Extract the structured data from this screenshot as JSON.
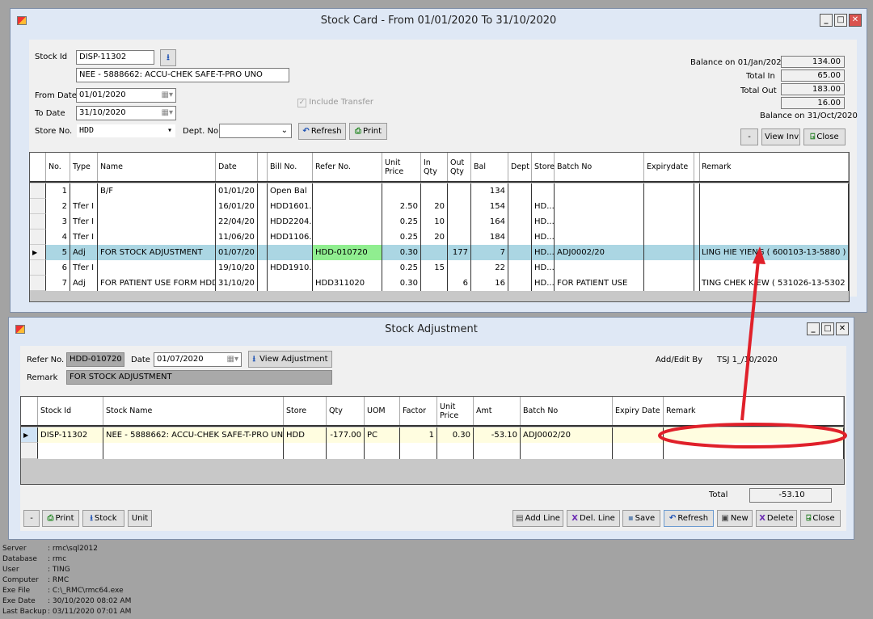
{
  "stock_card": {
    "title": "Stock Card - From 01/01/2020  To  31/10/2020",
    "stock_id_label": "Stock Id",
    "stock_id": "DISP-11302",
    "stock_name": "NEE - 5888662: ACCU-CHEK SAFE-T-PRO UNO",
    "from_date_label": "From Date",
    "from_date": "01/01/2020",
    "to_date_label": "To Date",
    "to_date": "31/10/2020",
    "store_label": "Store No.",
    "store": "HDD",
    "dept_label": "Dept. No",
    "dept": "",
    "include_transfer_label": "Include Transfer",
    "include_transfer_checked": true,
    "refresh_label": "Refresh",
    "print_label": "Print",
    "balance_open_label": "Balance on 01/Jan/2020",
    "balance_open": "134.00",
    "total_in_label": "Total In",
    "total_in": "65.00",
    "total_out_label": "Total Out",
    "total_out": "183.00",
    "balance_close": "16.00",
    "balance_close_label": "Balance on 31/Oct/2020",
    "minus_label": "-",
    "view_inv_label": "View Inv",
    "close_label": "Close",
    "columns": [
      "No.",
      "Type",
      "Name",
      "Date",
      "",
      "Bill No.",
      "Refer No.",
      "Unit Price",
      "In Qty",
      "Out Qty",
      "Bal",
      "Dept",
      "Store",
      "Batch No",
      "Expirydate",
      "",
      "Remark"
    ],
    "rows": [
      [
        "1",
        "",
        "B/F",
        "01/01/20",
        "",
        "Open Bal",
        "",
        "",
        "",
        "",
        "134",
        "",
        "",
        "",
        "",
        "",
        ""
      ],
      [
        "2",
        "Tfer I",
        "",
        "16/01/20",
        "",
        "HDD1601...",
        "",
        "2.50",
        "20",
        "",
        "154",
        "",
        "HD...",
        "",
        "",
        "",
        ""
      ],
      [
        "3",
        "Tfer I",
        "",
        "22/04/20",
        "",
        "HDD2204...",
        "",
        "0.25",
        "10",
        "",
        "164",
        "",
        "HD...",
        "",
        "",
        "",
        ""
      ],
      [
        "4",
        "Tfer I",
        "",
        "11/06/20",
        "",
        "HDD1106...",
        "",
        "0.25",
        "20",
        "",
        "184",
        "",
        "HD...",
        "",
        "",
        "",
        ""
      ],
      [
        "5",
        "Adj",
        "FOR STOCK ADJUSTMENT",
        "01/07/20",
        "",
        "",
        "HDD-010720",
        "0.30",
        "",
        "177",
        "7",
        "",
        "HD...",
        "ADJ0002/20",
        "",
        "",
        "LING HIE YIENG ( 600103-13-5880 )"
      ],
      [
        "6",
        "Tfer I",
        "",
        "19/10/20",
        "",
        "HDD1910...",
        "",
        "0.25",
        "15",
        "",
        "22",
        "",
        "HD...",
        "",
        "",
        "",
        ""
      ],
      [
        "7",
        "Adj",
        "FOR PATIENT USE FORM HDD",
        "31/10/20",
        "",
        "",
        "HDD311020",
        "0.30",
        "",
        "6",
        "16",
        "",
        "HD...",
        "FOR PATIENT USE",
        "",
        "",
        "TING CHEK KIEW ( 531026-13-5302 )"
      ]
    ],
    "selected_row": 4,
    "highlight_color": "#90ee90"
  },
  "stock_adjustment": {
    "title": "Stock Adjustment",
    "refer_label": "Refer No.",
    "refer_no": "HDD-010720",
    "date_label": "Date",
    "date": "01/07/2020",
    "view_adjustment_label": "View Adjustment",
    "remark_label": "Remark",
    "remark": "FOR STOCK ADJUSTMENT",
    "add_edit_label": "Add/Edit By",
    "add_edit_value": "TSJ 1_/10/2020",
    "columns": [
      "Stock Id",
      "Stock Name",
      "Store",
      "Qty",
      "UOM",
      "Factor",
      "Unit Price",
      "Amt",
      "Batch No",
      "Expiry Date",
      "Remark"
    ],
    "rows": [
      [
        "DISP-11302",
        "NEE - 5888662: ACCU-CHEK SAFE-T-PRO UNO",
        "HDD",
        "-177.00",
        "PC",
        "1",
        "0.30",
        "-53.10",
        "ADJ0002/20",
        "",
        ""
      ]
    ],
    "total_label": "Total",
    "total": "-53.10",
    "buttons_left": [
      "-",
      "Print",
      "Stock",
      "Unit"
    ],
    "buttons_right": [
      "Add Line",
      "Del. Line",
      "Save",
      "Refresh",
      "New",
      "Delete",
      "Close"
    ]
  },
  "status": [
    [
      "Server",
      ": rmc\\sql2012"
    ],
    [
      "Database",
      ": rmc"
    ],
    [
      "User",
      ": TING"
    ],
    [
      "Computer",
      ": RMC"
    ],
    [
      "Exe File",
      ": C:\\_RMC\\rmc64.exe"
    ],
    [
      "Exe Date",
      ": 30/10/2020 08:02 AM"
    ],
    [
      "Last Backup",
      ": 03/11/2020 07:01 AM"
    ]
  ],
  "annotation_color": "#e0202a"
}
